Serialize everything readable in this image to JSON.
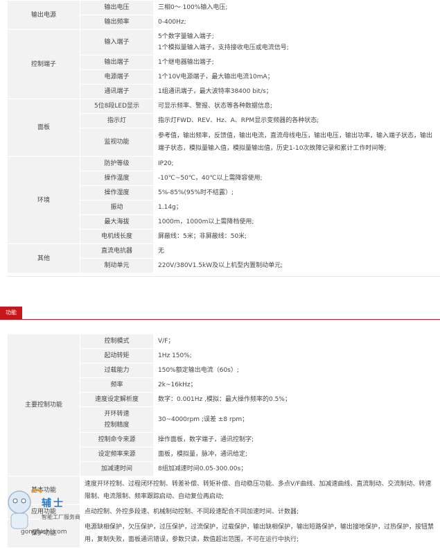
{
  "spec": {
    "output_power": {
      "label": "输出电源",
      "rows": [
        {
          "k": "输出电压",
          "v": "三相0～ 100%输入电压;"
        },
        {
          "k": "输出频率",
          "v": "0-400Hz;"
        }
      ]
    },
    "control_terminals": {
      "label": "控制端子",
      "rows": [
        {
          "k": "输入端子",
          "v1": "5个数字量输入端子;",
          "v2": "1个模拟量输入端子，支持接收电压或电流信号;"
        },
        {
          "k": "输出端子",
          "v": "1个继电器输出端子;"
        },
        {
          "k": "电源端子",
          "v": "1个10V电源端子，最大输出电流10mA；"
        },
        {
          "k": "通讯端子",
          "v": "1组通讯端子，最大波特率38400 bit/s；"
        }
      ]
    },
    "panel": {
      "label": "面板",
      "rows": [
        {
          "k": "5位8段LED显示",
          "v": "可显示频率、警报、状态等各种数据信息;"
        },
        {
          "k": "指示灯",
          "v": "指示灯FWD、REV、Hz、A、RPM显示变频器的各种状态;"
        },
        {
          "k": "监视功能",
          "v": "参考值，输出频率，反馈值，输出电流，直流母线电压，输出电压，输出功率，输入端子状态，输出端子状态，模拟量输入值，模拟量输出值，历史1-10次故障记录和累计工作时间等;"
        }
      ]
    },
    "environment": {
      "label": "环境",
      "rows": [
        {
          "k": "防护等级",
          "v": "IP20;"
        },
        {
          "k": "操作温度",
          "v": "-10℃~50℃，40℃以上需降容使用;"
        },
        {
          "k": "操作湿度",
          "v": "5%-85%(95%时不结露）;"
        },
        {
          "k": "振动",
          "v": "1.14g；"
        },
        {
          "k": "最大海拔",
          "v": "1000m，1000m以上需降档使用;"
        },
        {
          "k": "电机线长度",
          "v": "屏蔽线：5米；非屏蔽线：50米;"
        }
      ]
    },
    "other": {
      "label": "其他",
      "rows": [
        {
          "k": "直流电抗器",
          "v": "无"
        },
        {
          "k": "制动单元",
          "v": "220V/380V1.5kW及以上机型内置制动单元;"
        }
      ]
    }
  },
  "section_badge": "功能",
  "func": {
    "main": {
      "label": "主要控制功能",
      "rows": [
        {
          "k": "控制模式",
          "v": "V/F；"
        },
        {
          "k": "起动转矩",
          "v": "1Hz 150%;"
        },
        {
          "k": "过载能力",
          "v": "150%额定输出电流（60s）;"
        },
        {
          "k": "频率",
          "v": "2k~16kHz；"
        },
        {
          "k": "速度设定解析度",
          "v": "数字：0.001Hz ,模拟：最大操作频率的0.5%；"
        },
        {
          "k1": "开环转速",
          "k2": "控制精度",
          "v": "30~4000rpm ;误差 ±8 rpm；"
        },
        {
          "k": "控制命令来源",
          "v": "操作面板，数字端子，通讯控制字;"
        },
        {
          "k": "设定频率来源",
          "v": "面板，模拟量，脉冲，通讯给定;"
        },
        {
          "k": "加减速时间",
          "v": "8组加减速时间0.05-300.00s；"
        }
      ]
    },
    "basic": {
      "label": "基本功能",
      "v": "速度开环控制、过程闭环控制、转差补偿、转矩补偿、自动稳压功能、多点V/F曲线、加减速曲线、直流制动、交流制动、转速限制、电流限制、频率跟踪启动、自动复位再启动;"
    },
    "app": {
      "label": "应用功能",
      "v": "点动控制、外控多段速、机械制动控制、不同段速配合不同加速时间、计数器;"
    },
    "protect": {
      "label": "保护功能",
      "v": "电源缺相保护，欠压保护，过压保护，过流保护，过载保护，输出缺相保护，输出短路保护，输出接地保护，过热保护，按钮禁用，复制失败，面板通讯错误，参数只读，数值超出范围，不可在运行中执行;"
    }
  },
  "watermark": {
    "brand": "辅士",
    "line1": "智能工厂服务商",
    "url": "gongfushi.com"
  }
}
